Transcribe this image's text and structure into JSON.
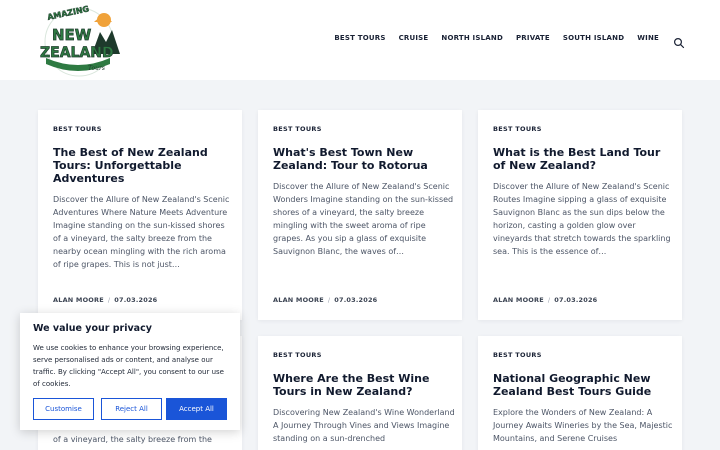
{
  "site": {
    "logo": {
      "top_text": "AMAZING",
      "main_text": "NEW ZEALAND",
      "sub_text": "Tours",
      "colors": {
        "text": "#2e7a42",
        "outline": "#1e3a2c",
        "sun": "#f0a23a"
      }
    },
    "nav": [
      "BEST TOURS",
      "CRUISE",
      "NORTH ISLAND",
      "PRIVATE",
      "SOUTH ISLAND",
      "WINE"
    ],
    "search_icon": "search-icon"
  },
  "posts": [
    {
      "category": "BEST TOURS",
      "title": "The Best of New Zealand Tours: Unforgettable Adventures",
      "excerpt": "Discover the Allure of New Zealand's Scenic Adventures Where Nature Meets Adventure Imagine standing on the sun-kissed shores of a vineyard, the salty breeze from the nearby ocean mingling with the rich aroma of ripe grapes. This is not just…",
      "author": "ALAN MOORE",
      "date": "07.03.2026"
    },
    {
      "category": "BEST TOURS",
      "title": "What's Best Town New Zealand: Tour to Rotorua",
      "excerpt": "Discover the Allure of New Zealand's Scenic Wonders Imagine standing on the sun-kissed shores of a vineyard, the salty breeze mingling with the sweet aroma of ripe grapes. As you sip a glass of exquisite Sauvignon Blanc, the waves of…",
      "author": "ALAN MOORE",
      "date": "07.03.2026"
    },
    {
      "category": "BEST TOURS",
      "title": "What is the Best Land Tour of New Zealand?",
      "excerpt": "Discover the Allure of New Zealand's Scenic Routes Imagine sipping a glass of exquisite Sauvignon Blanc as the sun dips below the horizon, casting a golden glow over vineyards that stretch towards the sparkling sea. This is the essence of…",
      "author": "ALAN MOORE",
      "date": "07.03.2026"
    },
    {
      "category": "",
      "title": "",
      "excerpt": "of a vineyard, the salty breeze from the",
      "author": "",
      "date": ""
    },
    {
      "category": "BEST TOURS",
      "title": "Where Are the Best Wine Tours in New Zealand?",
      "excerpt": "Discovering New Zealand's Wine Wonderland A Journey Through Vines and Views Imagine standing on a sun-drenched",
      "author": "",
      "date": ""
    },
    {
      "category": "BEST TOURS",
      "title": "National Geographic New Zealand Best Tours Guide",
      "excerpt": "Explore the Wonders of New Zealand: A Journey Awaits Wineries by the Sea, Majestic Mountains, and Serene Cruises",
      "author": "",
      "date": ""
    }
  ],
  "cookie_banner": {
    "title": "We value your privacy",
    "text": "We use cookies to enhance your browsing experience, serve personalised ads or content, and analyse our traffic. By clicking \"Accept All\", you consent to our use of cookies.",
    "customise_label": "Customise",
    "reject_label": "Reject All",
    "accept_label": "Accept All",
    "accent_color": "#1a55d8"
  }
}
